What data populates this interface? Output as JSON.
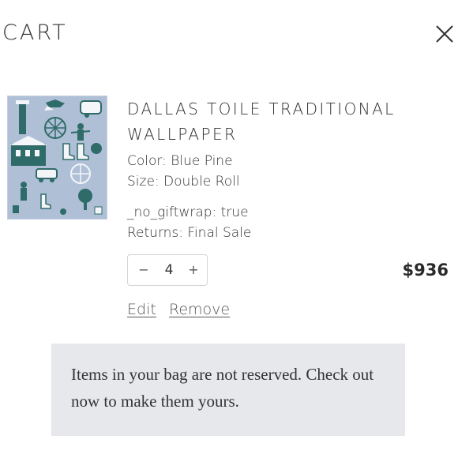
{
  "header": {
    "title": "CART",
    "close_icon": "close-icon"
  },
  "item": {
    "title_line1": "DALLAS TOILE TRADITIONAL",
    "title_line2": "WALLPAPER",
    "color": "Color: Blue Pine",
    "size": "Size: Double Roll",
    "giftwrap": "_no_giftwrap: true",
    "returns": "Returns: Final Sale",
    "quantity": "4",
    "minus_label": "−",
    "plus_label": "+",
    "price": "$936",
    "edit_label": "Edit",
    "remove_label": "Remove",
    "thumbnail_colors": {
      "background": "#aebfd6",
      "ink": "#2f6b68",
      "light": "#f3f5f8"
    }
  },
  "notice": {
    "text": "Items in your bag are not reserved. Check out now to make them yours."
  }
}
